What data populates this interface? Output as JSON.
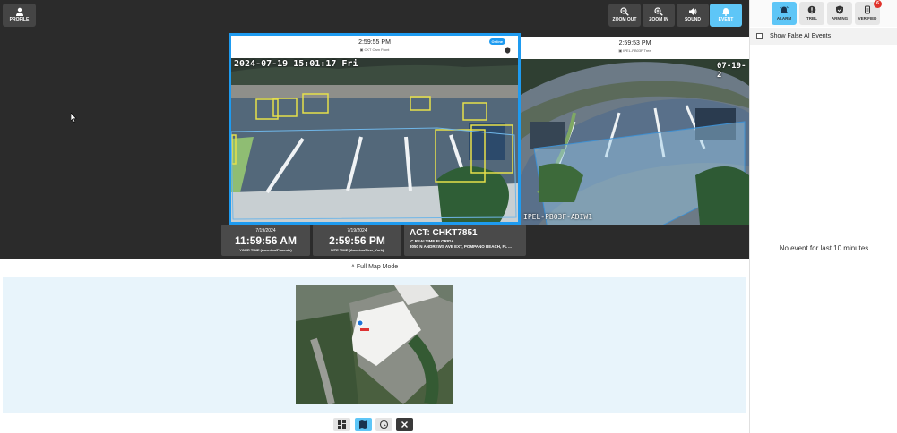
{
  "header": {
    "profile_label": "PROFILE",
    "controls": [
      {
        "label": "ZOOM OUT",
        "icon": "zoom-out-icon"
      },
      {
        "label": "ZOOM IN",
        "icon": "zoom-in-icon"
      },
      {
        "label": "SOUND",
        "icon": "sound-icon"
      },
      {
        "label": "EVENT",
        "icon": "bell-icon"
      }
    ]
  },
  "cameras": [
    {
      "time": "2:59:55 PM",
      "name": "CKT Cam Front",
      "status": "Online",
      "overlay_timestamp": "2024-07-19 15:01:17 Fri"
    },
    {
      "time": "2:59:53 PM",
      "name": "IPEL-PB03F Tree",
      "overlay_timestamp": "07-19-2",
      "overlay_label": "IPEL-PB03F-ADIW1"
    }
  ],
  "info": {
    "your_date": "7/19/2024",
    "your_time": "11:59:56 AM",
    "your_label": "YOUR TIME (America/Phoenix)",
    "site_date": "7/19/2024",
    "site_time": "2:59:56 PM",
    "site_label": "SITE TIME (America/New_York)",
    "account": "ACT: CHKT7851",
    "company": "IC REALTIME FLORIDA",
    "address": "3050 N ANDREWS AVE EXT, POMPANO BEACH, FL ..."
  },
  "map": {
    "mode_label": "Full Map Mode"
  },
  "right_panel": {
    "tabs": [
      {
        "label": "ALARM",
        "icon": "alarm-icon"
      },
      {
        "label": "TRBL",
        "icon": "trouble-icon"
      },
      {
        "label": "ARMING",
        "icon": "shield-icon"
      },
      {
        "label": "VERIFIED",
        "icon": "verified-icon",
        "count": "6"
      }
    ],
    "show_false_ai_label": "Show False AI Events",
    "empty_message": "No event for last 10 minutes"
  },
  "colors": {
    "accent": "#5ec6f7",
    "selected_border": "#1e9bf0",
    "detection": "#e6e04a"
  }
}
